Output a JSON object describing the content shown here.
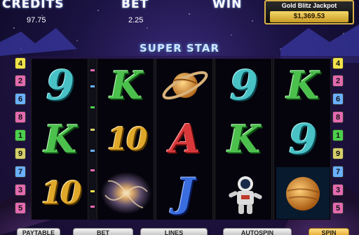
{
  "meters": {
    "credits_label": "CREDITS",
    "credits_value": "97.75",
    "bet_label": "BET",
    "bet_value": "2.25",
    "win_label": "WIN"
  },
  "jackpot": {
    "title": "Gold Blitz Jackpot",
    "value": "$1,369.53"
  },
  "game_title": "SUPER STAR",
  "reels": [
    [
      "9",
      "K",
      "10"
    ],
    [
      "K",
      "10",
      "galaxy"
    ],
    [
      "saturn",
      "A",
      "J"
    ],
    [
      "9",
      "K",
      "astronaut"
    ],
    [
      "K",
      "9",
      "planet"
    ]
  ],
  "paylines_left": [
    "4",
    "2",
    "6",
    "8",
    "1",
    "9",
    "7",
    "3",
    "5"
  ],
  "paylines_right": [
    "4",
    "2",
    "6",
    "8",
    "1",
    "9",
    "7",
    "3",
    "5"
  ],
  "payline_colors": {
    "1": "#4ccf4c",
    "2": "#e46ab0",
    "3": "#e46ab0",
    "4": "#f2e24a",
    "5": "#e46ab0",
    "6": "#6ab0ff",
    "7": "#6ab0ff",
    "8": "#e46ab0",
    "9": "#d6d06a"
  },
  "buttons": {
    "paytable": "PAYTABLE",
    "bet": "BET",
    "lines": "LINES",
    "autospin": "AUTOSPIN",
    "spin": "SPIN"
  }
}
